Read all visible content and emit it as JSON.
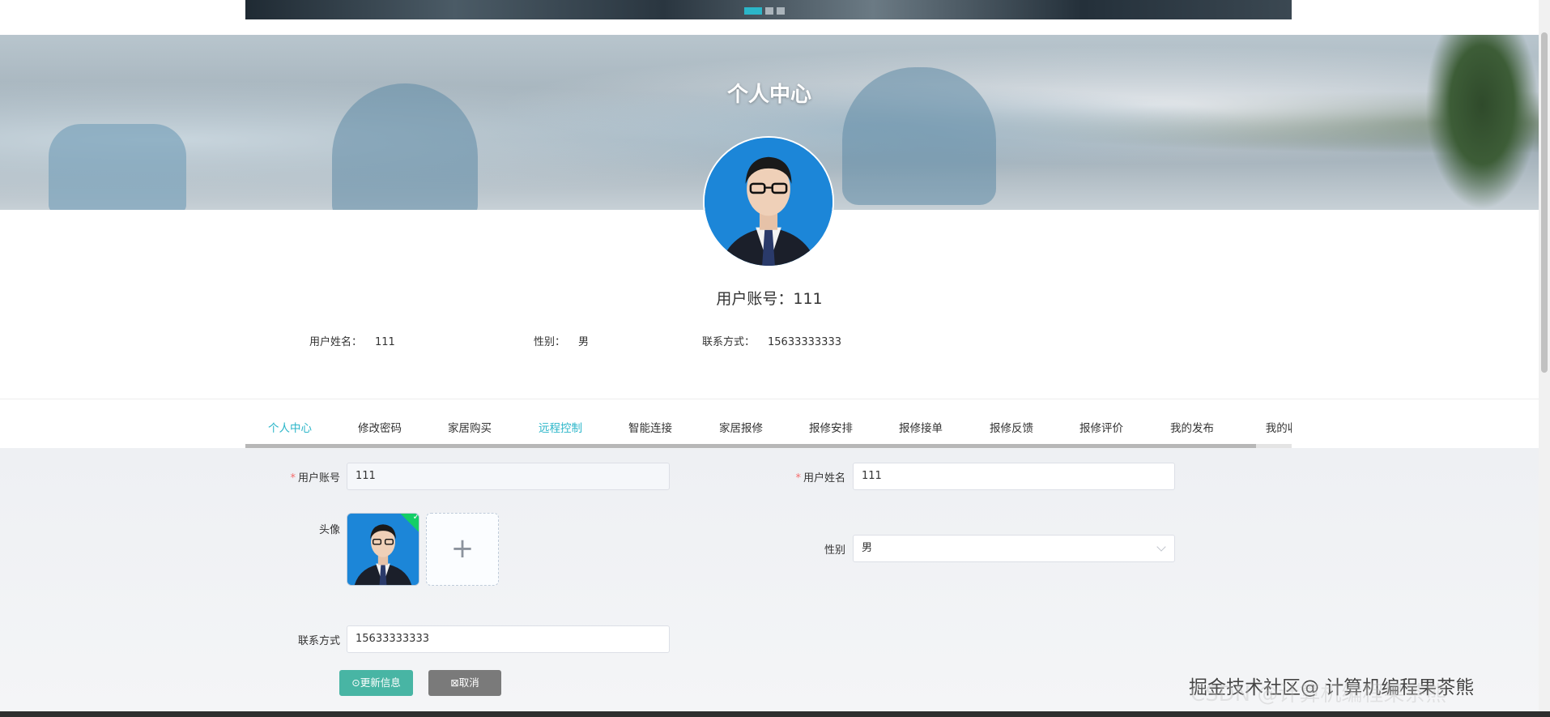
{
  "hero": {
    "title": "个人中心"
  },
  "profile": {
    "account_label": "用户账号：",
    "account_value": "111",
    "name_label": "用户姓名：",
    "name_value": "111",
    "gender_label": "性别：",
    "gender_value": "男",
    "phone_label": "联系方式：",
    "phone_value": "15633333333"
  },
  "tabs": [
    {
      "label": "个人中心",
      "state": "active"
    },
    {
      "label": "修改密码",
      "state": "normal"
    },
    {
      "label": "家居购买",
      "state": "normal"
    },
    {
      "label": "远程控制",
      "state": "hover"
    },
    {
      "label": "智能连接",
      "state": "normal"
    },
    {
      "label": "家居报修",
      "state": "normal"
    },
    {
      "label": "报修安排",
      "state": "normal"
    },
    {
      "label": "报修接单",
      "state": "normal"
    },
    {
      "label": "报修反馈",
      "state": "normal"
    },
    {
      "label": "报修评价",
      "state": "normal"
    },
    {
      "label": "我的发布",
      "state": "normal"
    },
    {
      "label": "我的收",
      "state": "normal"
    }
  ],
  "form": {
    "account_label": "用户账号",
    "account_value": "111",
    "name_label": "用户姓名",
    "name_value": "111",
    "avatar_label": "头像",
    "add_symbol": "+",
    "gender_label": "性别",
    "gender_value": "男",
    "phone_label": "联系方式",
    "phone_value": "15633333333"
  },
  "buttons": {
    "update": "⊙更新信息",
    "cancel": "⊠取消"
  },
  "watermark": {
    "text": "掘金技术社区@ 计算机编程果茶熊",
    "ghost": "CSDN @计算机编程果茶熊"
  },
  "colors": {
    "accent": "#2bb6c9",
    "update_button": "#48b5a4",
    "cancel_button": "#7a7a7a",
    "required": "#f56c6c"
  }
}
